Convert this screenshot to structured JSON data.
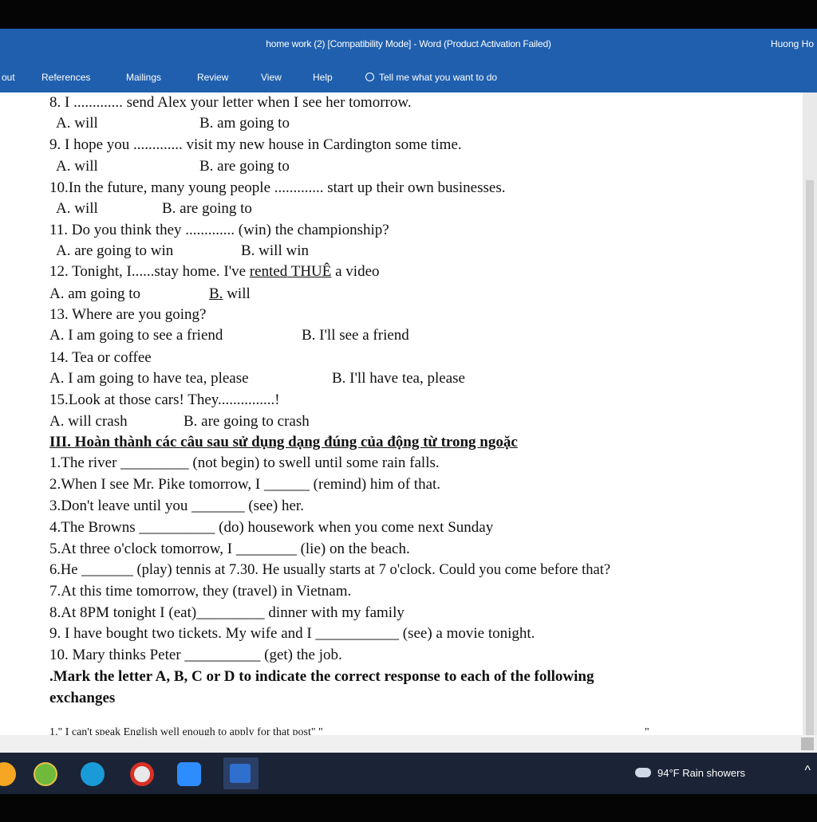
{
  "window": {
    "title": "home work (2) [Compatibility Mode] - Word (Product Activation Failed)",
    "user": "Huong Ho"
  },
  "ribbon": {
    "tabs": [
      "out",
      "References",
      "Mailings",
      "Review",
      "View",
      "Help"
    ],
    "tell_me": "Tell me what you want to do"
  },
  "document": {
    "lines": [
      "8. I ............. send Alex your letter when I see her tomorrow.",
      "A. will",
      "B. am going to",
      "9. I hope you ............. visit my new house in Cardington some time.",
      "A. will",
      "B. are going to",
      "10.In the future, many young people ............. start up their own businesses.",
      "A. will",
      "B. are going to",
      "11. Do you think they ............. (win) the championship?",
      "A. are going to win",
      "B. will win",
      "12. Tonight, I......stay home. I've ",
      "rented",
      " THUÊ",
      " a video",
      "A. am going to",
      "B.",
      " will",
      "13. Where are you going?",
      "A. I am going to see a friend",
      "B. I'll see a friend",
      "14. Tea or coffee",
      "A. I am going to have tea, please",
      "B. I'll have tea, please",
      "15.Look at those cars! They...............!",
      "A. will crash",
      "B. are going to crash",
      "III. Hoàn thành các câu sau sử dụng dạng đúng của động từ trong ngoặc",
      "1.The river _________ (not begin) to swell until some rain falls.",
      "2.When I see Mr. Pike tomorrow, I ______ (remind) him of that.",
      "3.Don't leave until you _______ (see) her.",
      "4.The Browns __________ (do) housework when you come next Sunday",
      "5.At three o'clock tomorrow, I ________ (lie) on the beach.",
      "6.He _______ (play) tennis at 7.30. He usually starts at 7 o'clock. Could you come before that?",
      "7.At this time tomorrow, they (travel) in Vietnam.",
      "8.At 8PM tonight I (eat)_________ dinner with my family",
      "9. I have bought two tickets. My wife and I ___________ (see) a movie tonight.",
      "10. Mary thinks Peter __________ (get) the job.",
      ".Mark the letter A, B, C or D to indicate the correct response to each of the following",
      "exchanges",
      "1.\" I can't speak English well enough to apply for that post\" \"",
      "\""
    ]
  },
  "taskbar": {
    "weather": "94°F  Rain showers",
    "icons": [
      "edge-icon",
      "chrome-icon",
      "zoom-icon",
      "word-icon"
    ]
  }
}
